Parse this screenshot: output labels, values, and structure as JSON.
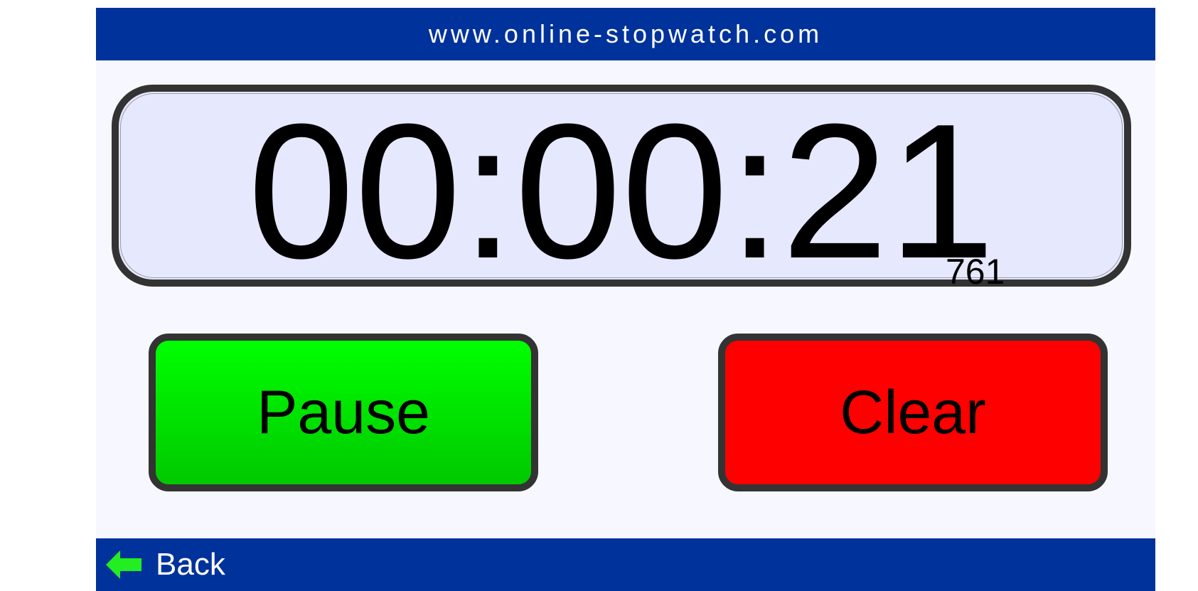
{
  "header": {
    "title": "www.online-stopwatch.com"
  },
  "display": {
    "time": "00:00:21",
    "milliseconds": "761"
  },
  "controls": {
    "pause_label": "Pause",
    "clear_label": "Clear"
  },
  "footer": {
    "back_label": "Back",
    "back_icon": "back-arrow-icon"
  },
  "colors": {
    "bar_blue": "#00329b",
    "pause_green": "#00ff00",
    "clear_red": "#ff0000",
    "display_bg": "#e6e8fd",
    "border_dark": "#333333",
    "back_arrow_green": "#22ee22"
  }
}
